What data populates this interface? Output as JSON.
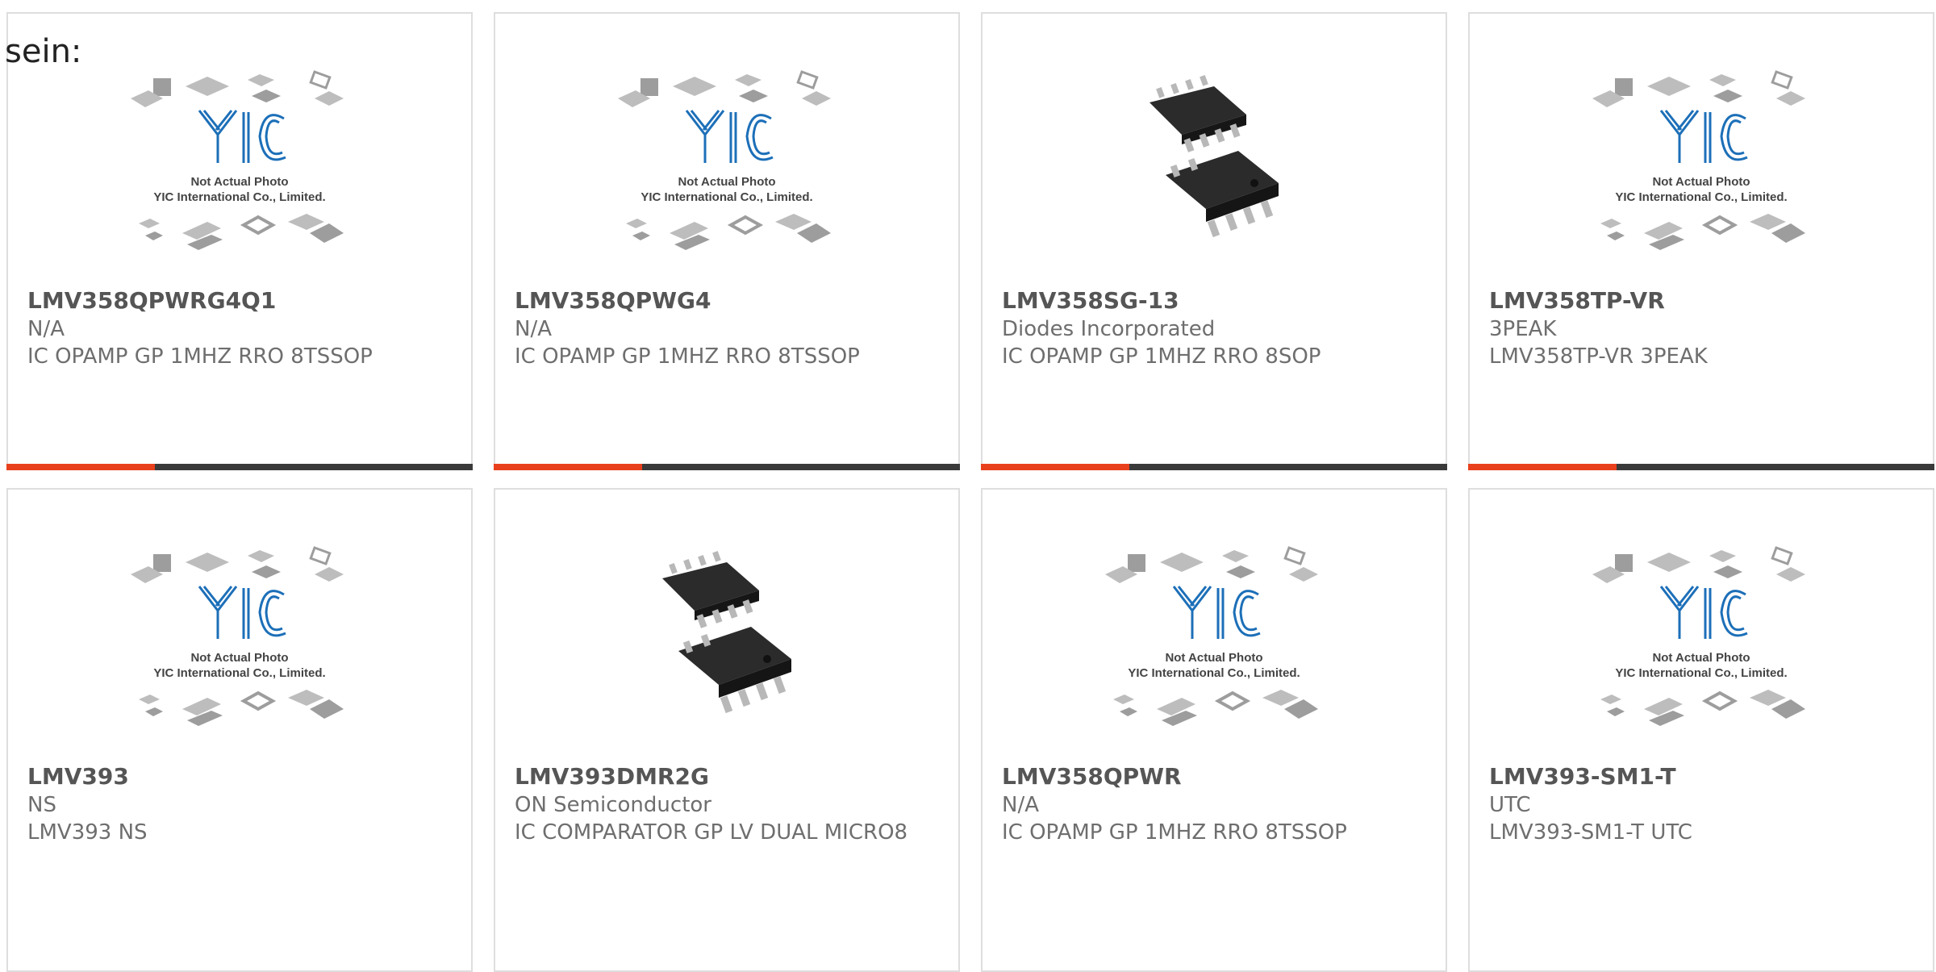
{
  "heading": "sein:",
  "placeholder": {
    "line1": "Not Actual Photo",
    "line2": "YIC International Co., Limited.",
    "logo": "YIC"
  },
  "colors": {
    "accent": "#e8401c",
    "bar": "#3a3a3a",
    "logo_blue": "#1c6fb8",
    "text": "#6e6e6e"
  },
  "products": [
    {
      "part": "LMV358QPWRG4Q1",
      "maker": "N/A",
      "desc": "IC OPAMP GP 1MHZ RRO 8TSSOP",
      "image": "placeholder"
    },
    {
      "part": "LMV358QPWG4",
      "maker": "N/A",
      "desc": "IC OPAMP GP 1MHZ RRO 8TSSOP",
      "image": "placeholder"
    },
    {
      "part": "LMV358SG-13",
      "maker": "Diodes Incorporated",
      "desc": "IC OPAMP GP 1MHZ RRO 8SOP",
      "image": "photo"
    },
    {
      "part": "LMV358TP-VR",
      "maker": "3PEAK",
      "desc": "LMV358TP-VR 3PEAK",
      "image": "placeholder"
    },
    {
      "part": "LMV393",
      "maker": "NS",
      "desc": "LMV393 NS",
      "image": "placeholder"
    },
    {
      "part": "LMV393DMR2G",
      "maker": "ON Semiconductor",
      "desc": "IC COMPARATOR GP LV DUAL MICRO8",
      "image": "photo"
    },
    {
      "part": "LMV358QPWR",
      "maker": "N/A",
      "desc": "IC OPAMP GP 1MHZ RRO 8TSSOP",
      "image": "placeholder"
    },
    {
      "part": "LMV393-SM1-T",
      "maker": "UTC",
      "desc": "LMV393-SM1-T UTC",
      "image": "placeholder"
    }
  ]
}
